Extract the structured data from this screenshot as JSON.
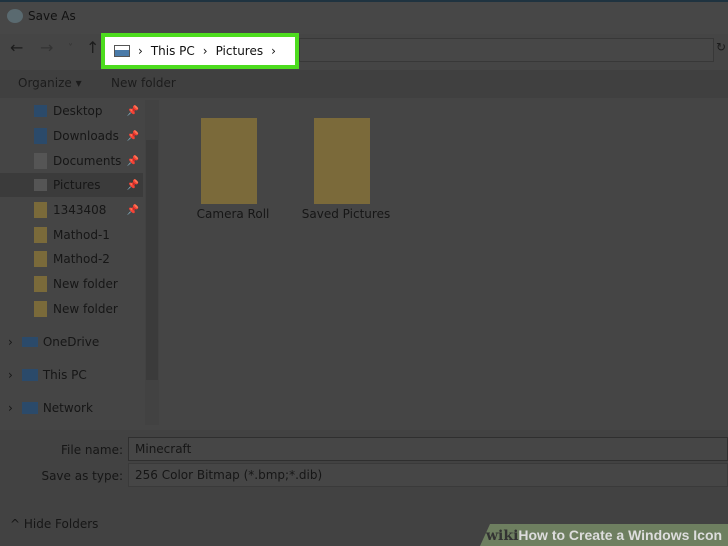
{
  "window": {
    "title": "Save As"
  },
  "address": {
    "segments": [
      "This PC",
      "Pictures"
    ]
  },
  "toolbar": {
    "organize": "Organize ▾",
    "new_folder": "New folder"
  },
  "sidebar": {
    "items": [
      {
        "label": "Desktop",
        "pinned": true
      },
      {
        "label": "Downloads",
        "pinned": true
      },
      {
        "label": "Documents",
        "pinned": true
      },
      {
        "label": "Pictures",
        "pinned": true,
        "selected": true
      },
      {
        "label": "1343408",
        "pinned": true
      },
      {
        "label": "Mathod-1"
      },
      {
        "label": "Mathod-2"
      },
      {
        "label": "New folder"
      },
      {
        "label": "New folder"
      }
    ],
    "roots": [
      "OneDrive",
      "This PC",
      "Network"
    ]
  },
  "files": [
    "Camera Roll",
    "Saved Pictures"
  ],
  "form": {
    "file_name_label": "File name:",
    "file_name": "Minecraft",
    "type_label": "Save as type:",
    "type": "256 Color Bitmap (*.bmp;*.dib)"
  },
  "hide_folders": "Hide Folders",
  "watermark": {
    "wiki": "wiki",
    "text": "How to Create a Windows Icon"
  }
}
